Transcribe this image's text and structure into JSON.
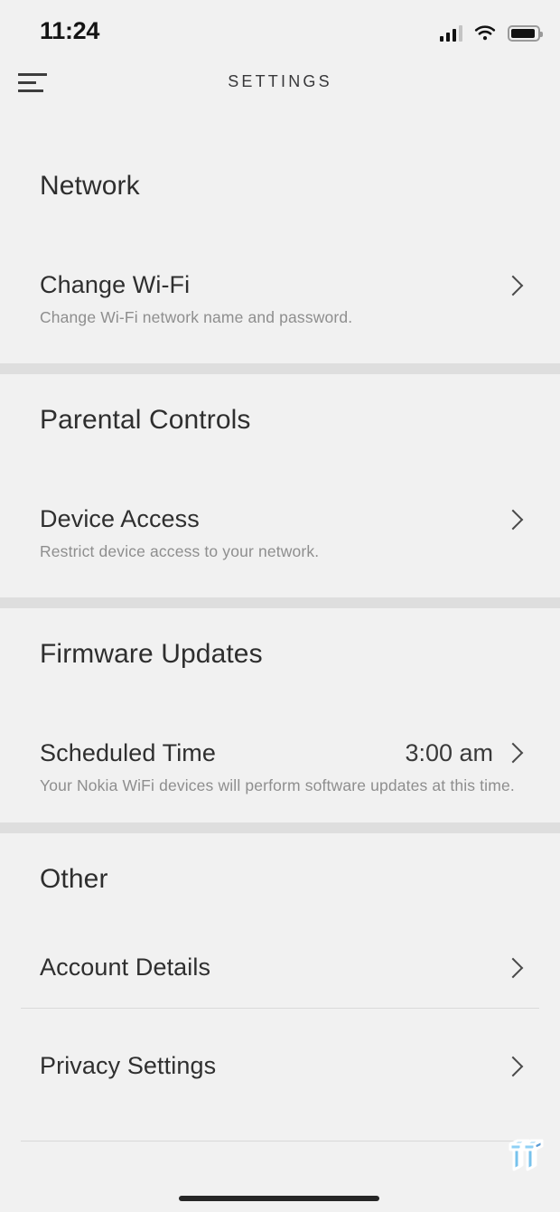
{
  "statusbar": {
    "time": "11:24",
    "icons": [
      "signal-bars-icon",
      "wifi-icon",
      "battery-icon"
    ],
    "signal_bars_filled": 3,
    "signal_bars_total": 4,
    "battery_level_pct": 92
  },
  "header": {
    "menu_icon": "hamburger-menu-icon",
    "title": "SETTINGS"
  },
  "sections": [
    {
      "title": "Network",
      "rows": [
        {
          "title": "Change Wi-Fi",
          "subtitle": "Change Wi-Fi network name and password.",
          "value": "",
          "accessory": "chevron-right-icon"
        }
      ]
    },
    {
      "title": "Parental Controls",
      "rows": [
        {
          "title": "Device Access",
          "subtitle": "Restrict device access to your network.",
          "value": "",
          "accessory": "chevron-right-icon"
        }
      ]
    },
    {
      "title": "Firmware Updates",
      "rows": [
        {
          "title": "Scheduled Time",
          "subtitle": "Your Nokia WiFi devices will perform software updates at this time.",
          "value": "3:00 am",
          "accessory": "chevron-right-icon"
        }
      ]
    },
    {
      "title": "Other",
      "rows": [
        {
          "title": "Account Details",
          "subtitle": "",
          "value": "",
          "accessory": "chevron-right-icon"
        },
        {
          "title": "Privacy Settings",
          "subtitle": "",
          "value": "",
          "accessory": "chevron-right-icon"
        }
      ]
    }
  ],
  "watermark": {
    "name": "tweaktown-tt-logo-watermark"
  },
  "colors": {
    "background": "#f1f1f1",
    "section_divider": "#dedede",
    "hairline": "#d9d9d9",
    "title_text": "#2e2e2e",
    "subtitle_text": "#8e8e8e",
    "status_text": "#141414",
    "home_indicator": "#262626",
    "watermark_blue": "#79b8e8"
  }
}
